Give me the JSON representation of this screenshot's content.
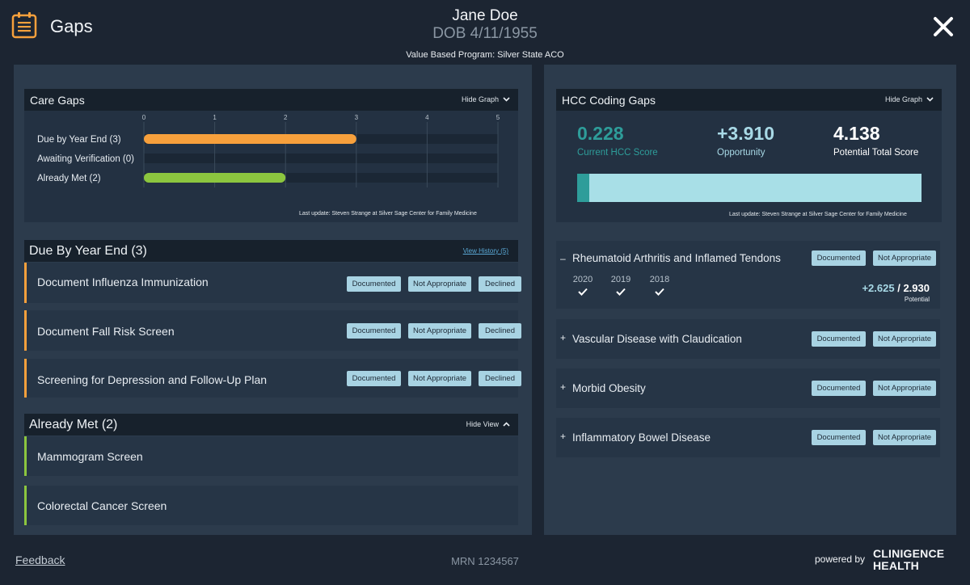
{
  "header": {
    "title": "Gaps",
    "patient_name": "Jane Doe",
    "dob": "DOB 4/11/1955",
    "program": "Value Based Program:  Silver State ACO"
  },
  "care_gaps": {
    "title": "Care Gaps",
    "hide_graph": "Hide Graph",
    "last_update": "Last update: Steven Strange at  Silver Sage Center for Family Medicine"
  },
  "chart_data": {
    "type": "bar",
    "orientation": "horizontal",
    "categories": [
      "Due by Year End (3)",
      "Awaiting Verification (0)",
      "Already Met (2)"
    ],
    "values": [
      3,
      0,
      2
    ],
    "colors": [
      "#f7a03c",
      "#f7a03c",
      "#8cc63f"
    ],
    "xlim": [
      0,
      5
    ],
    "xticks": [
      "0",
      "1",
      "2",
      "3",
      "4",
      "5"
    ],
    "grid": true
  },
  "due": {
    "title": "Due By Year End (3)",
    "history": "View History (5)",
    "items": [
      {
        "label": "Document Influenza Immunization"
      },
      {
        "label": "Document Fall Risk Screen"
      },
      {
        "label": "Screening for Depression and Follow-Up Plan"
      }
    ],
    "btn_documented": "Documented",
    "btn_not_appropriate": "Not Appropriate",
    "btn_declined": "Declined",
    "accent": "#f7a03c"
  },
  "met": {
    "title": "Already Met (2)",
    "hide_view": "Hide View",
    "items": [
      {
        "label": "Mammogram Screen"
      },
      {
        "label": "Colorectal Cancer Screen"
      }
    ],
    "accent": "#8cc63f"
  },
  "hcc": {
    "title": "HCC Coding Gaps",
    "hide_graph": "Hide Graph",
    "current_score": "0.228",
    "current_label": "Current HCC Score",
    "opportunity": "+3.910",
    "opportunity_label": "Opportunity",
    "potential_total": "4.138",
    "potential_total_label": "Potential Total Score",
    "current_fraction": 0.035,
    "last_update": "Last update: Steven Strange at  Silver Sage Center for Family Medicine",
    "accent": "#2e9d9a",
    "conditions": [
      {
        "symbol": "–",
        "label": "Rheumatoid Arthritis and Inflamed Tendons",
        "expanded": true
      },
      {
        "symbol": "+",
        "label": "Vascular Disease with Claudication"
      },
      {
        "symbol": "+",
        "label": "Morbid Obesity"
      },
      {
        "symbol": "+",
        "label": "Inflammatory Bowel Disease"
      }
    ],
    "years": [
      "2020",
      "2019",
      "2018"
    ],
    "ra_score": "+2.625",
    "ra_separator": "/",
    "ra_potential_value": "2.930",
    "ra_potential_label": "Potential",
    "btn_documented": "Documented",
    "btn_not_appropriate": "Not Appropriate"
  },
  "footer": {
    "feedback": "Feedback",
    "mrn": "MRN 1234567",
    "powered_by": "powered by",
    "brand_line1": "CLINIGENCE",
    "brand_line2": "HEALTH"
  },
  "icons": {
    "header": "notepad-icon",
    "close": "close-icon",
    "chevron": "chevron-down-icon",
    "chevron_up": "chevron-up-icon",
    "check": "check-icon"
  }
}
